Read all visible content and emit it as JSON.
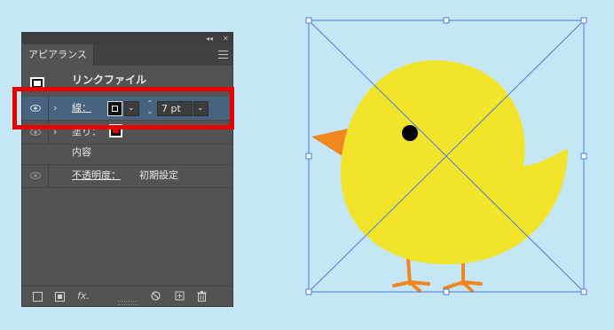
{
  "panel": {
    "title_tab": "アピアランス",
    "collapse_glyph": "◂◂",
    "close_glyph": "✕",
    "rows": {
      "link_file": "リンクファイル",
      "stroke_label": "線：",
      "stroke_weight": "7 pt",
      "fill_label": "塗り：",
      "contents": "内容",
      "opacity_label": "不透明度：",
      "opacity_value": "初期設定"
    },
    "bottom": {
      "fx_label": "fx."
    }
  },
  "colors": {
    "panel_bg": "#535353",
    "selected_row": "#47637f",
    "highlight": "#e60000",
    "canvas_bg": "#c5e6f5",
    "chick_body": "#f2e42a",
    "beak_feet": "#f0861e",
    "bounding_box": "#4a7be0"
  },
  "icons": [
    "eye-icon",
    "chevron-right-icon",
    "menu-icon",
    "new-stroke-icon",
    "new-fill-icon",
    "fx-icon",
    "clear-icon",
    "duplicate-icon",
    "trash-icon"
  ]
}
